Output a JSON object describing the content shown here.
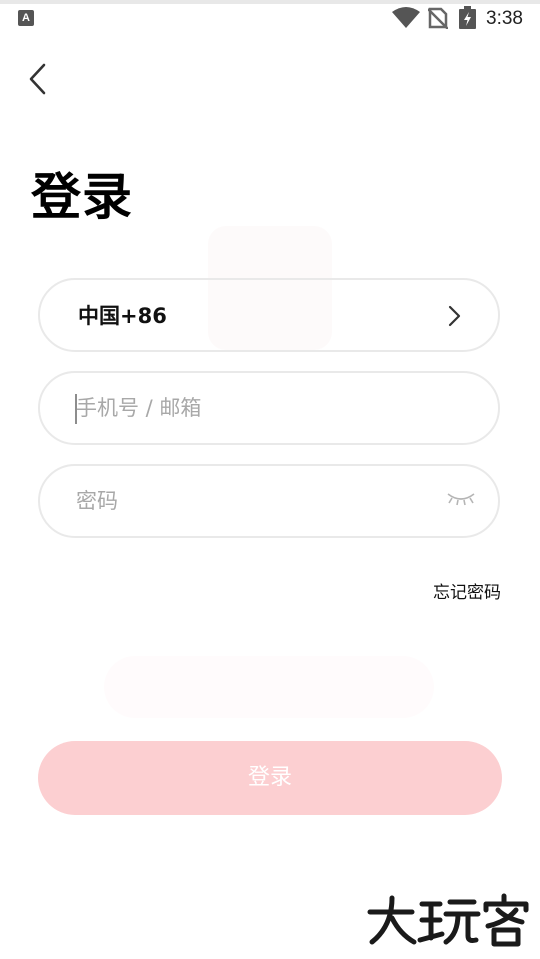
{
  "status_bar": {
    "app_icon_letter": "A",
    "time": "3:38",
    "icons": [
      "wifi-icon",
      "no-sim-icon",
      "battery-charging-icon"
    ]
  },
  "header": {
    "back_icon": "chevron-left-icon",
    "title": "登录"
  },
  "form": {
    "country": {
      "label": "中国+86",
      "icon": "chevron-right-icon"
    },
    "account": {
      "value": "",
      "placeholder": "手机号 / 邮箱"
    },
    "password": {
      "value": "",
      "placeholder": "密码",
      "icon": "eye-closed-icon"
    },
    "forgot_label": "忘记密码",
    "submit_label": "登录",
    "submit_color": "#fccfd1"
  },
  "watermark": {
    "text": "大玩客"
  }
}
